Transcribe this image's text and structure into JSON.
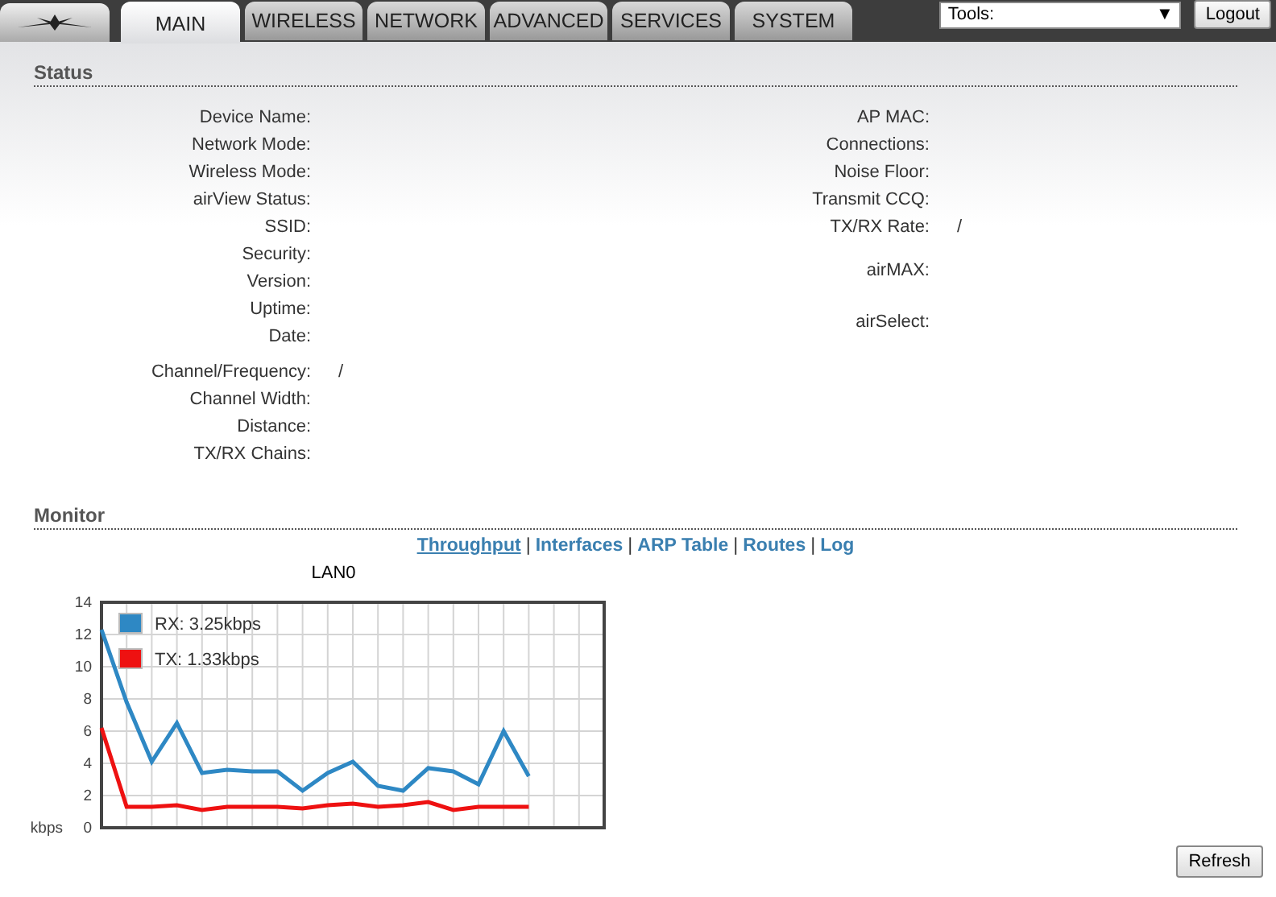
{
  "tabs": [
    {
      "label": "MAIN",
      "selected": true
    },
    {
      "label": "WIRELESS",
      "selected": false
    },
    {
      "label": "NETWORK",
      "selected": false
    },
    {
      "label": "ADVANCED",
      "selected": false
    },
    {
      "label": "SERVICES",
      "selected": false
    },
    {
      "label": "SYSTEM",
      "selected": false
    }
  ],
  "tools": {
    "value": "Tools:",
    "arrow": "▼"
  },
  "logout": "Logout",
  "status": {
    "title": "Status",
    "left": [
      [
        {
          "label": "Device Name:"
        },
        {
          "label": "Network Mode:"
        },
        {
          "label": "Wireless Mode:"
        },
        {
          "label": "airView Status:"
        },
        {
          "label": "SSID:"
        },
        {
          "label": "Security:"
        },
        {
          "label": "Version:"
        },
        {
          "label": "Uptime:"
        },
        {
          "label": "Date:"
        }
      ],
      [
        {
          "label": "Channel/Frequency:",
          "value": "/"
        },
        {
          "label": "Channel Width:"
        },
        {
          "label": "Distance:"
        },
        {
          "label": "TX/RX Chains:"
        }
      ]
    ],
    "right": [
      [
        {
          "label": "AP MAC:"
        },
        {
          "label": "Connections:"
        },
        {
          "label": "Noise Floor:"
        },
        {
          "label": "Transmit CCQ:"
        },
        {
          "label": "TX/RX Rate:",
          "value": "/"
        }
      ],
      [
        {
          "label": "airMAX:"
        }
      ],
      [
        {
          "label": "airSelect:"
        }
      ]
    ]
  },
  "monitor": {
    "title": "Monitor",
    "separator": "|",
    "links": [
      {
        "label": "Throughput",
        "selected": true
      },
      {
        "label": "Interfaces",
        "selected": false
      },
      {
        "label": "ARP Table",
        "selected": false
      },
      {
        "label": "Routes",
        "selected": false
      },
      {
        "label": "Log",
        "selected": false
      }
    ],
    "chart_data": {
      "type": "line",
      "title": "LAN0",
      "ylabel": "kbps",
      "categories": [
        null,
        null,
        null,
        null,
        null,
        null,
        null,
        null,
        null,
        null,
        null,
        null,
        null,
        null,
        null,
        null,
        null,
        null
      ],
      "grid": true,
      "legend": "top-left",
      "ylim": [
        0,
        14
      ],
      "yticks": [
        0,
        2,
        4,
        6,
        8,
        10,
        12,
        14
      ],
      "series": [
        {
          "name": "RX: 3.25kbps",
          "color": "#2e88c4",
          "values": [
            12.3,
            7.8,
            4.1,
            6.5,
            3.4,
            3.6,
            3.5,
            3.5,
            2.3,
            3.4,
            4.1,
            2.6,
            2.3,
            3.7,
            3.5,
            2.7,
            6.0,
            3.2
          ]
        },
        {
          "name": "TX: 1.33kbps",
          "color": "#ee1111",
          "values": [
            6.2,
            1.3,
            1.3,
            1.4,
            1.1,
            1.3,
            1.3,
            1.3,
            1.2,
            1.4,
            1.5,
            1.3,
            1.4,
            1.6,
            1.1,
            1.3,
            1.3,
            1.3
          ]
        }
      ]
    }
  },
  "refresh": "Refresh"
}
